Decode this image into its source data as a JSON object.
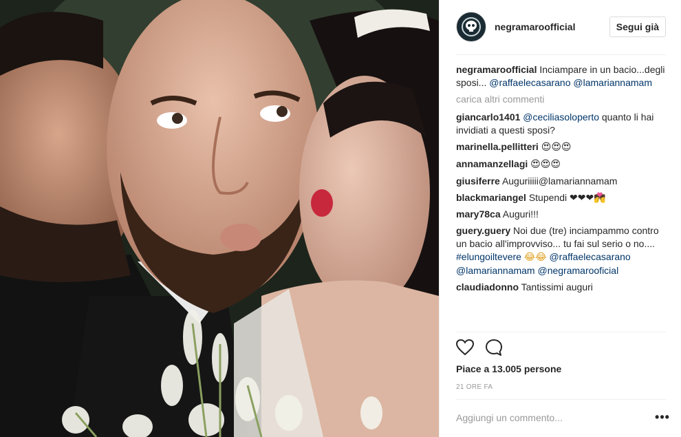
{
  "post": {
    "username": "negramaroofficial",
    "follow_label": "Segui già",
    "photo_icon": "selfie-photo"
  },
  "caption": {
    "user": "negramaroofficial",
    "text": "Inciampare in un bacio...degli sposi...",
    "mentions": [
      "@raffaelecasarano",
      "@lamariannamam"
    ]
  },
  "load_more_label": "carica altri commenti",
  "comments": [
    {
      "user": "giancarlo1401",
      "mention": "@ceciliasoloperto",
      "text": "quanto li hai invidiati a questi sposi?"
    },
    {
      "user": "marinella.pellitteri",
      "text": "😍😍😍"
    },
    {
      "user": "annamanzellagi",
      "text": "😍😍😍"
    },
    {
      "user": "giusiferre",
      "text": "Auguriiiii@lamariannamam"
    },
    {
      "user": "blackmariangel",
      "text": "Stupendi ❤❤❤💏"
    },
    {
      "user": "mary78ca",
      "text": "Auguri!!!"
    },
    {
      "user": "guery.guery",
      "text": "Noi due (tre) inciampammo contro un bacio all'improvviso... tu fai sul serio o no....",
      "hashtag": "#elungoiltevere",
      "emoji": "😂😂",
      "mentions": [
        "@raffaelecasarano",
        "@lamariannamam",
        "@negramarooficial"
      ]
    },
    {
      "user": "claudiadonno",
      "text": "Tantissimi auguri"
    }
  ],
  "likes_label": "Piace a 13.005 persone",
  "time_label": "21 ORE FA",
  "add_comment_placeholder": "Aggiungi un commento...",
  "more_label": "•••",
  "icons": {
    "like": "heart-icon",
    "comment": "comment-bubble-icon",
    "more": "more-options-icon"
  },
  "colors": {
    "link": "#003569",
    "muted": "#999999",
    "border": "#efefef"
  }
}
